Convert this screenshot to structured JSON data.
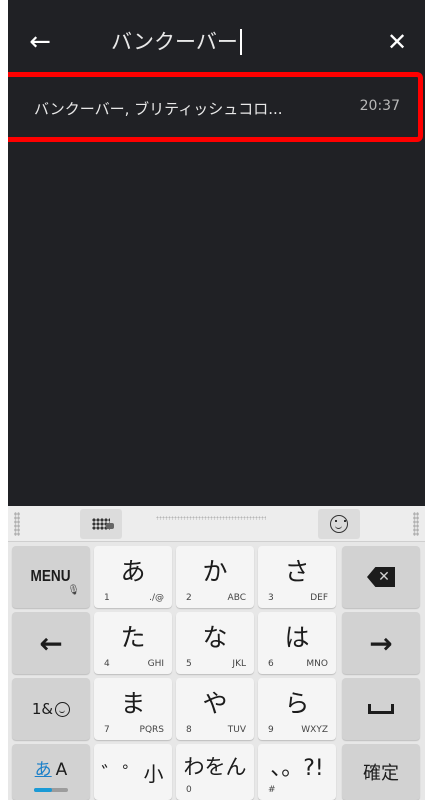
{
  "search": {
    "back_icon": "arrow-left-icon",
    "query": "バンクーバー",
    "clear_icon": "close-icon"
  },
  "results": [
    {
      "label": "バンクーバー, ブリティッシュコロ...",
      "time": "20:37"
    }
  ],
  "highlight_color": "#ff0000",
  "keyboard": {
    "toolbar": {
      "mode_icon": "input-mode-icon",
      "emoji_icon": "emoji-face-icon"
    },
    "rows": [
      [
        {
          "id": "menu",
          "label": "MENU"
        },
        {
          "id": "a",
          "main": "あ",
          "num": "1",
          "sub": "./@"
        },
        {
          "id": "ka",
          "main": "か",
          "num": "2",
          "sub": "ABC"
        },
        {
          "id": "sa",
          "main": "さ",
          "num": "3",
          "sub": "DEF"
        },
        {
          "id": "backspace",
          "icon": "backspace-icon"
        }
      ],
      [
        {
          "id": "left",
          "icon": "arrow-left-icon",
          "glyph": "←"
        },
        {
          "id": "ta",
          "main": "た",
          "num": "4",
          "sub": "GHI"
        },
        {
          "id": "na",
          "main": "な",
          "num": "5",
          "sub": "JKL"
        },
        {
          "id": "ha",
          "main": "は",
          "num": "6",
          "sub": "MNO"
        },
        {
          "id": "right",
          "icon": "arrow-right-icon",
          "glyph": "→"
        }
      ],
      [
        {
          "id": "symbols",
          "label": "1&"
        },
        {
          "id": "ma",
          "main": "ま",
          "num": "7",
          "sub": "PQRS"
        },
        {
          "id": "ya",
          "main": "や",
          "num": "8",
          "sub": "TUV"
        },
        {
          "id": "ra",
          "main": "ら",
          "num": "9",
          "sub": "WXYZ"
        },
        {
          "id": "space",
          "icon": "space-icon"
        }
      ],
      [
        {
          "id": "kana-mode",
          "label_a": "あ",
          "label_b": "A"
        },
        {
          "id": "modifiers",
          "label": "゛゜小"
        },
        {
          "id": "wa",
          "label": "わをん",
          "num": "0"
        },
        {
          "id": "punct",
          "label": "、。?!",
          "num": "#"
        },
        {
          "id": "confirm",
          "label": "確定"
        }
      ]
    ]
  }
}
